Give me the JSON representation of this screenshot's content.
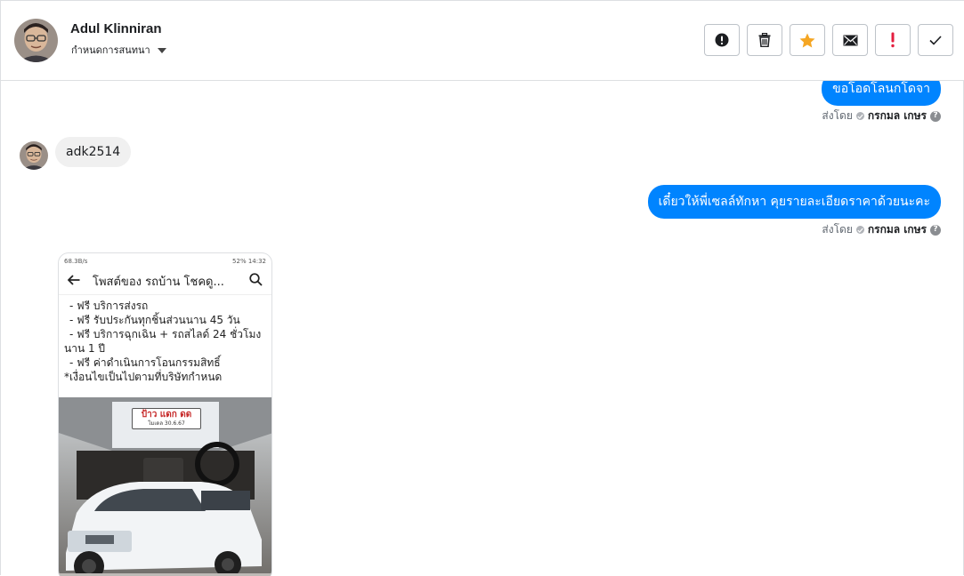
{
  "header": {
    "contact_name": "Adul Klinniran",
    "conversation_label": "กำหนดการสนทนา",
    "actions": [
      {
        "name": "report-button",
        "icon": "exclamation-circle-icon"
      },
      {
        "name": "delete-button",
        "icon": "trash-icon"
      },
      {
        "name": "star-button",
        "icon": "star-icon",
        "color": "#f5a623"
      },
      {
        "name": "mark-unread-button",
        "icon": "envelope-icon"
      },
      {
        "name": "mark-spam-button",
        "icon": "exclamation-icon",
        "color": "#e41e3f"
      },
      {
        "name": "mark-done-button",
        "icon": "checkmark-icon"
      }
    ]
  },
  "messages": {
    "out1": {
      "text": "ขอโอดโลนกโดจา",
      "sent_by_label": "ส่งโดย",
      "agent": "กรกมล เกษร"
    },
    "in1": {
      "text": "adk2514"
    },
    "out2": {
      "text": "เดี๋ยวให้พี่เซลล์ทักหา คุยรายละเอียดราคาด้วยนะคะ",
      "sent_by_label": "ส่งโดย",
      "agent": "กรกมล เกษร"
    },
    "attachment": {
      "status_left": "68.3B/s",
      "status_right": "52% 14:32",
      "nav_title": "โพสต์ของ รถบ้าน โชคดู...",
      "lines": [
        "- ฟรี บริการส่งรถ",
        "- ฟรี รับประกันทุกชิ้นส่วนนาน 45 วัน",
        "- ฟรี บริการฉุกเฉิน + รถสไลด์ 24 ชั่วโมง",
        "นาน 1 ปี",
        "- ฟรี ค่าดำเนินการโอนกรรมสิทธิ์",
        "*เงื่อนไขเป็นไปตามที่บริษัทกำหนด"
      ],
      "sign_text": "ป้าว แดก ดด",
      "sign_sub": "โมเดล 30.6.67"
    }
  },
  "colors": {
    "bubble_out": "#0084ff",
    "bubble_in": "#f0f0f0",
    "star": "#f5a623",
    "spam": "#e41e3f"
  }
}
